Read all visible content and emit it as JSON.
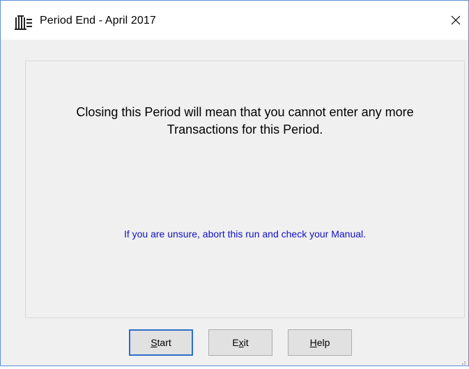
{
  "window": {
    "title": "Period End - April 2017",
    "app_icon": "building-columns-icon",
    "close_icon": "close-icon"
  },
  "message": {
    "line1": "Closing this Period will mean that you cannot enter any more",
    "line2": "Transactions for this Period.",
    "warning": "If you are unsure, abort this run and check your Manual."
  },
  "buttons": {
    "start": {
      "mnemonic": "S",
      "rest": "tart"
    },
    "exit": {
      "pre": "E",
      "mnemonic": "x",
      "rest": "it"
    },
    "help": {
      "mnemonic": "H",
      "rest": "elp"
    }
  },
  "colors": {
    "warning_text": "#1010c8",
    "default_button_border": "#2c6ec9",
    "window_border": "#5a8fd6"
  }
}
